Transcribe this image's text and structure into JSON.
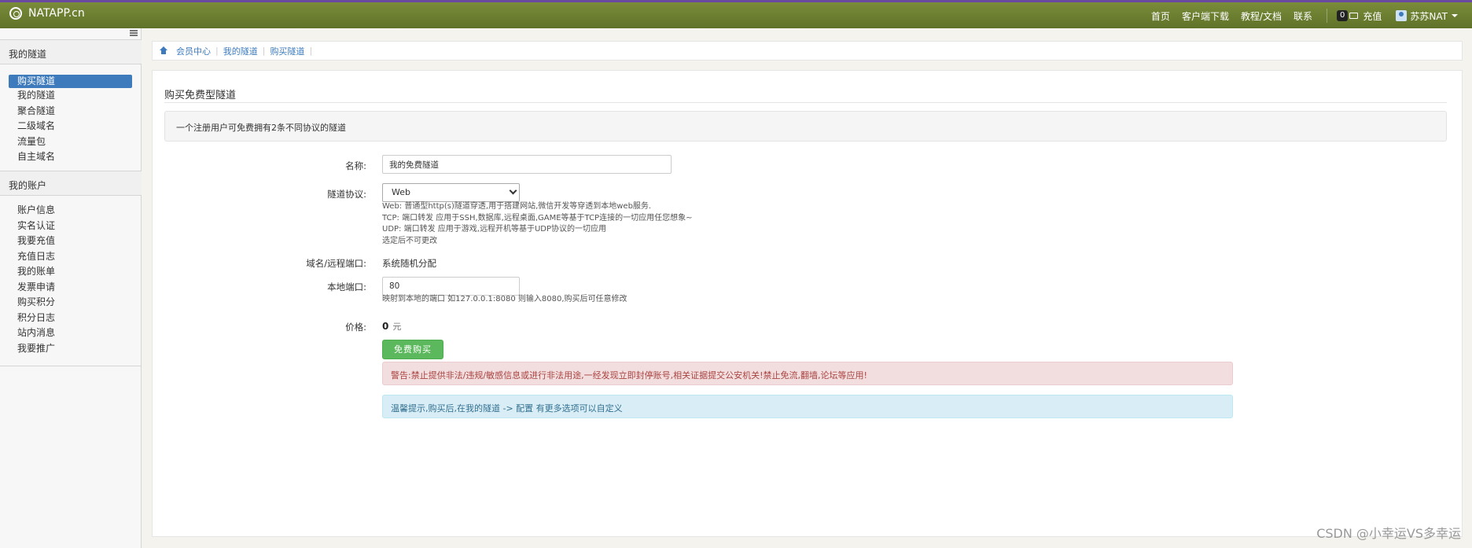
{
  "app": {
    "brand": "NATAPP.cn"
  },
  "topnav": {
    "links": [
      "首页",
      "客户端下载",
      "教程/文档",
      "联系"
    ],
    "balance_badge": "0",
    "recharge": "充值",
    "user": "苏苏NAT"
  },
  "sidebar": {
    "section1_title": "我的隧道",
    "section1_items": [
      "购买隧道",
      "我的隧道",
      "聚合隧道",
      "二级域名",
      "流量包",
      "自主域名"
    ],
    "section2_title": "我的账户",
    "section2_items": [
      "账户信息",
      "实名认证",
      "我要充值",
      "充值日志",
      "我的账单",
      "发票申请",
      "购买积分",
      "积分日志",
      "站内消息",
      "我要推广"
    ]
  },
  "breadcrumb": [
    "会员中心",
    "我的隧道",
    "购买隧道"
  ],
  "panel": {
    "title": "购买免费型隧道",
    "notice": "一个注册用户可免费拥有2条不同协议的隧道"
  },
  "form": {
    "name_label": "名称:",
    "name_value": "我的免费隧道",
    "protocol_label": "隧道协议:",
    "protocol_value": "Web",
    "protocol_help": [
      "Web: 普通型http(s)隧道穿透,用于搭建网站,微信开发等穿透到本地web服务.",
      "TCP: 端口转发 应用于SSH,数据库,远程桌面,GAME等基于TCP连接的一切应用任您想象~",
      "UDP: 端口转发 应用于游戏,远程开机等基于UDP协议的一切应用",
      "选定后不可更改"
    ],
    "domain_label": "域名/远程端口:",
    "domain_value": "系统随机分配",
    "port_label": "本地端口:",
    "port_value": "80",
    "port_help": "映射到本地的端口 如127.0.0.1:8080 则输入8080,购买后可任意修改",
    "price_label": "价格:",
    "price_value": "0",
    "price_unit": "元",
    "buy_button": "免费购买",
    "warning": "警告:禁止提供非法/违规/敏感信息或进行非法用途,一经发现立即封停账号,相关证据提交公安机关!禁止免流,翻墙,论坛等应用!",
    "tip": "温馨提示,购买后,在我的隧道 -> 配置 有更多选项可以自定义"
  },
  "watermark": "CSDN @小幸运VS多幸运",
  "colors": {
    "navbar": "#6d8032",
    "accent": "#3d7bbd",
    "success": "#5cb85c",
    "danger_bg": "#f2dede",
    "info_bg": "#d9edf7"
  }
}
